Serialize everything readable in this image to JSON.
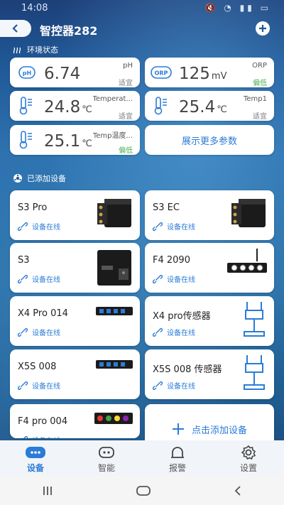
{
  "status_bar": {
    "time": "14:08",
    "icons": "🔇 ◔ ▮▮ ▭"
  },
  "header": {
    "title": "智控器282"
  },
  "env_section": {
    "title": "环境状态"
  },
  "params": [
    {
      "badge": "pH",
      "value": "6.74",
      "unit": "",
      "name": "pH",
      "state": "适宜",
      "state_color": "#777777"
    },
    {
      "badge": "ORP",
      "value": "125",
      "unit": "mV",
      "name": "ORP",
      "state": "偏低",
      "state_color": "#4caf50"
    },
    {
      "badge": "thermometer",
      "value": "24.8",
      "unit": "℃",
      "name": "Temperat...",
      "state": "适宜",
      "state_color": "#777777"
    },
    {
      "badge": "thermometer",
      "value": "25.4",
      "unit": "℃",
      "name": "Temp1",
      "state": "适宜",
      "state_color": "#777777"
    },
    {
      "badge": "thermometer",
      "value": "25.1",
      "unit": "℃",
      "name": "Temp温度...",
      "state": "偏低",
      "state_color": "#4caf50"
    }
  ],
  "more_params": {
    "label": "展示更多参数"
  },
  "dev_section": {
    "title": "已添加设备"
  },
  "devices": [
    {
      "name": "S3 Pro",
      "status": "设备在线"
    },
    {
      "name": "S3 EC",
      "status": "设备在线"
    },
    {
      "name": "S3",
      "status": "设备在线"
    },
    {
      "name": "F4 2090",
      "status": "设备在线"
    },
    {
      "name": "X4 Pro 014",
      "status": "设备在线"
    },
    {
      "name": "X4 pro传感器",
      "status": "设备在线"
    },
    {
      "name": "X5S 008",
      "status": "设备在线"
    },
    {
      "name": "X5S 008 传感器",
      "status": "设备在线"
    },
    {
      "name": "F4 pro 004",
      "status": "设备在线"
    }
  ],
  "add_device": {
    "label": "点击添加设备"
  },
  "nav": [
    {
      "label": "设备",
      "icon": "device-icon"
    },
    {
      "label": "智能",
      "icon": "robot-icon"
    },
    {
      "label": "报警",
      "icon": "alarm-icon"
    },
    {
      "label": "设置",
      "icon": "gear-icon"
    }
  ],
  "colors": {
    "accent": "#2a7cd6",
    "ok": "#777777",
    "low": "#4caf50"
  }
}
